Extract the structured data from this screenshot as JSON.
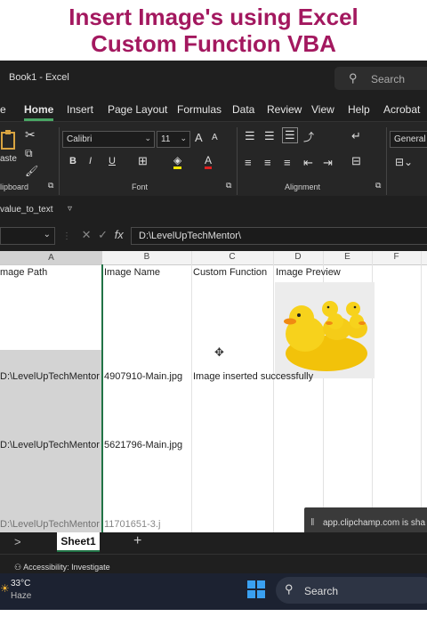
{
  "banner": {
    "line1": "Insert Image's using Excel",
    "line2": "Custom Function VBA"
  },
  "window": {
    "title": "Book1 - Excel",
    "search_placeholder": "Search"
  },
  "menu": {
    "items": [
      "e",
      "Home",
      "Insert",
      "Page Layout",
      "Formulas",
      "Data",
      "Review",
      "View",
      "Help",
      "Acrobat"
    ],
    "active": "Home"
  },
  "ribbon": {
    "clipboard": {
      "paste": "aste",
      "label": "lipboard"
    },
    "font": {
      "name": "Calibri",
      "size": "11",
      "label": "Font",
      "bold": "B",
      "italic": "I",
      "underline": "U",
      "grow": "A",
      "shrink": "A"
    },
    "alignment": {
      "label": "Alignment"
    },
    "number": {
      "format": "General"
    }
  },
  "macro": {
    "name": "value_to_text"
  },
  "formula_bar": {
    "fx": "fx",
    "value": "D:\\LevelUpTechMentor\\"
  },
  "columns": [
    "A",
    "B",
    "C",
    "D",
    "E",
    "F"
  ],
  "headers": {
    "a": "mage Path",
    "b": "Image Name",
    "c": "Custom Function",
    "d": "Image Preview"
  },
  "rows": [
    {
      "a": "D:\\LevelUpTechMentor",
      "b": "4907910-Main.jpg",
      "c": "Image inserted successfully"
    },
    {
      "a": "D:\\LevelUpTechMentor",
      "b": "5621796-Main.jpg",
      "c": ""
    },
    {
      "a": "D:\\LevelUpTechMentor",
      "b": "11701651-3.j",
      "c": ""
    }
  ],
  "sheet": {
    "tab": "Sheet1",
    "add": "+",
    "nav": ">"
  },
  "status": {
    "accessibility": "Accessibility: Investigate"
  },
  "toast": {
    "text": "app.clipchamp.com is sha"
  },
  "taskbar": {
    "temp": "33°C",
    "condition": "Haze",
    "search": "Search"
  },
  "colors": {
    "banner": "#a3185f",
    "excel_green": "#217346",
    "dark": "#1f1f1f",
    "taskbar": "#1c2231"
  }
}
